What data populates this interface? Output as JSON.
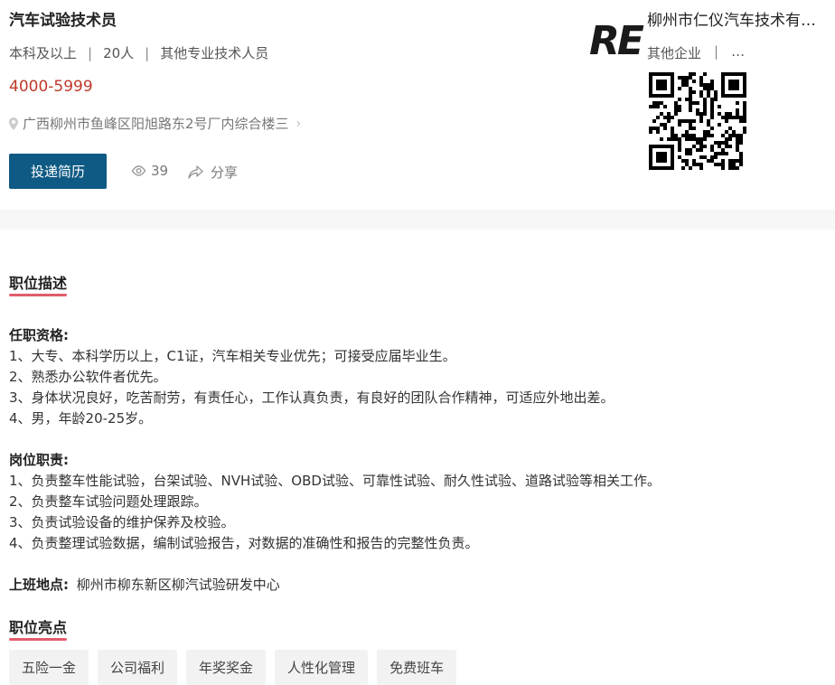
{
  "job": {
    "title": "汽车试验技术员",
    "education": "本科及以上",
    "headcount": "20人",
    "category": "其他专业技术人员",
    "salary": "4000-5999",
    "address": "广西柳州市鱼峰区阳旭路东2号厂内综合楼三",
    "apply_label": "投递简历",
    "views": "39",
    "share_label": "分享",
    "sep": "|"
  },
  "company": {
    "name": "柳州市仁仪汽车技术有限公司",
    "type": "其他企业",
    "more": "…",
    "logo_text": "RE",
    "colors": {
      "accent": "#0f5a84",
      "salary": "#c0392b",
      "underline": "#e35d6a"
    }
  },
  "description": {
    "section_title": "职位描述",
    "qualifications_title": "任职资格:",
    "qualifications": [
      "1、大专、本科学历以上，C1证，汽车相关专业优先；可接受应届毕业生。",
      "2、熟悉办公软件者优先。",
      "3、身体状况良好，吃苦耐劳，有责任心，工作认真负责，有良好的团队合作精神，可适应外地出差。",
      "4、男，年龄20-25岁。"
    ],
    "duties_title": "岗位职责:",
    "duties": [
      "1、负责整车性能试验，台架试验、NVH试验、OBD试验、可靠性试验、耐久性试验、道路试验等相关工作。",
      "2、负责整车试验问题处理跟踪。",
      "3、负责试验设备的维护保养及校验。",
      "4、负责整理试验数据，编制试验报告，对数据的准确性和报告的完整性负责。"
    ],
    "workplace_label": "上班地点:",
    "workplace": "柳州市柳东新区柳汽试验研发中心"
  },
  "highlights": {
    "section_title": "职位亮点",
    "tags": [
      "五险一金",
      "公司福利",
      "年奖奖金",
      "人性化管理",
      "免费班车"
    ]
  }
}
